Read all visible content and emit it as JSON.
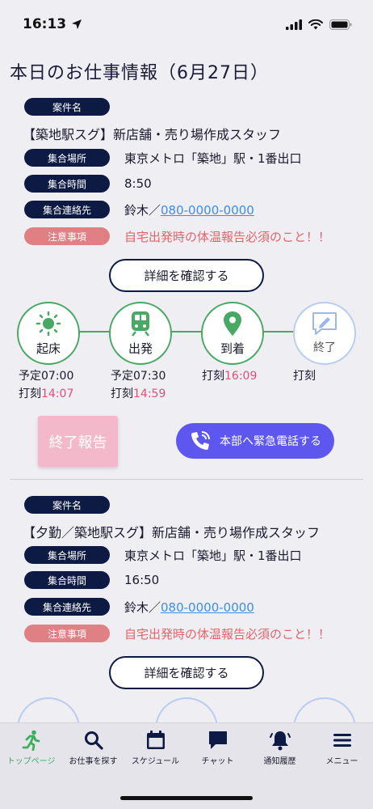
{
  "status": {
    "time": "16:13"
  },
  "page_title": "本日のお仕事情報（6月27日）",
  "jobs": [
    {
      "case_label": "案件名",
      "case_name": "【築地駅スグ】新店舗・売り場作成スタッフ",
      "place_label": "集合場所",
      "place": "東京メトロ「築地」駅・1番出口",
      "time_label": "集合時間",
      "time": "8:50",
      "contact_label": "集合連絡先",
      "contact_name": "鈴木／",
      "contact_phone": "080-0000-0000",
      "notice_label": "注意事項",
      "notice": "自宅出発時の体温報告必須のこと！！",
      "detail_button": "詳細を確認する"
    },
    {
      "case_label": "案件名",
      "case_name": "【夕勤／築地駅スグ】新店舗・売り場作成スタッフ",
      "place_label": "集合場所",
      "place": "東京メトロ「築地」駅・1番出口",
      "time_label": "集合時間",
      "time": "16:50",
      "contact_label": "集合連絡先",
      "contact_name": "鈴木／",
      "contact_phone": "080-0000-0000",
      "notice_label": "注意事項",
      "notice": "自宅出発時の体温報告必須のこと！！",
      "detail_button": "詳細を確認する"
    }
  ],
  "steps": [
    {
      "label": "起床",
      "icon": "sun-icon",
      "scheduled_label": "予定",
      "scheduled": "07:00",
      "stamp_label": "打刻",
      "stamp": "14:07"
    },
    {
      "label": "出発",
      "icon": "train-icon",
      "scheduled_label": "予定",
      "scheduled": "07:30",
      "stamp_label": "打刻",
      "stamp": "14:59"
    },
    {
      "label": "到着",
      "icon": "location-pin-icon",
      "stamp_label": "打刻",
      "stamp": "16:09"
    },
    {
      "label": "終了",
      "icon": "report-icon",
      "stamp_label": "打刻"
    }
  ],
  "buttons": {
    "finish_report": "終了報告",
    "emergency_call": "本部へ緊急電話する"
  },
  "tabs": [
    {
      "label": "トップページ",
      "icon": "running-person-icon"
    },
    {
      "label": "お仕事を探す",
      "icon": "search-icon"
    },
    {
      "label": "スケジュール",
      "icon": "calendar-icon"
    },
    {
      "label": "チャット",
      "icon": "chat-icon"
    },
    {
      "label": "通知履歴",
      "icon": "bell-icon"
    },
    {
      "label": "メニュー",
      "icon": "menu-icon"
    }
  ],
  "colors": {
    "navy": "#0d1a44",
    "green": "#4aa865",
    "alert": "#e07f84",
    "accent_blue": "#5d57f0",
    "stamp_pink": "#e0507b"
  }
}
